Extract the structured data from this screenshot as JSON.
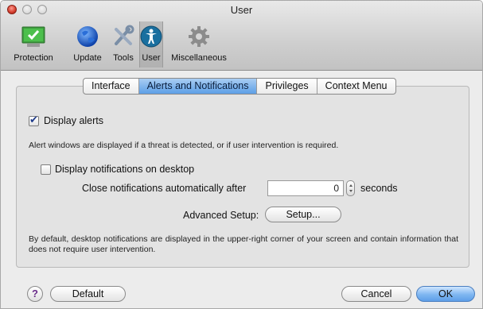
{
  "window": {
    "title": "User"
  },
  "toolbar": {
    "items": [
      {
        "label": "Protection",
        "icon": "monitor-check-icon"
      },
      {
        "label": "Update",
        "icon": "globe-icon"
      },
      {
        "label": "Tools",
        "icon": "tools-icon"
      },
      {
        "label": "User",
        "icon": "user-accessibility-icon",
        "selected": true
      },
      {
        "label": "Miscellaneous",
        "icon": "gear-icon"
      }
    ]
  },
  "tabs": [
    {
      "label": "Interface"
    },
    {
      "label": "Alerts and Notifications",
      "active": true
    },
    {
      "label": "Privileges"
    },
    {
      "label": "Context Menu"
    }
  ],
  "alerts": {
    "display_alerts_label": "Display alerts",
    "display_alerts_checked": true,
    "description": "Alert windows are displayed if a threat is detected, or if user intervention is required."
  },
  "notifications": {
    "display_label": "Display notifications on desktop",
    "display_checked": false,
    "close_label": "Close notifications automatically after",
    "close_value": "0",
    "seconds_label": "seconds",
    "advanced_label": "Advanced Setup:",
    "setup_button": "Setup...",
    "description": "By default, desktop notifications are displayed in the upper-right corner of your screen and contain information that does not require user intervention."
  },
  "footer": {
    "help": "?",
    "default_button": "Default",
    "cancel_button": "Cancel",
    "ok_button": "OK"
  },
  "colors": {
    "accent": "#5d9fe6",
    "window_bg": "#ececec"
  }
}
